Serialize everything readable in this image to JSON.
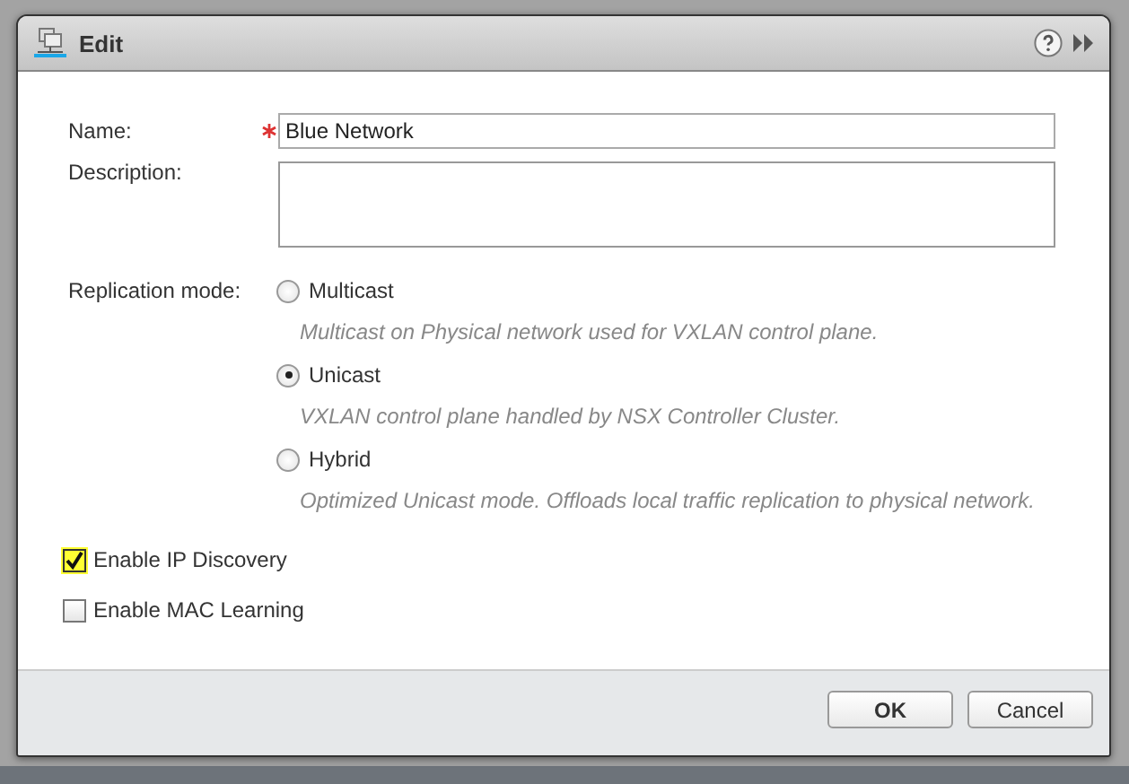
{
  "dialog": {
    "title": "Edit"
  },
  "name_field": {
    "label": "Name:",
    "required": true,
    "value": "Blue Network"
  },
  "description_field": {
    "label": "Description:"
  },
  "replication_mode": {
    "label": "Replication mode:",
    "options": [
      {
        "label": "Multicast",
        "selected": false,
        "description": "Multicast on Physical network used for VXLAN control plane."
      },
      {
        "label": "Unicast",
        "selected": true,
        "description": "VXLAN control plane handled by NSX Controller Cluster."
      },
      {
        "label": "Hybrid",
        "selected": false,
        "description": "Optimized Unicast mode. Offloads local traffic replication to physical network."
      }
    ]
  },
  "checkboxes": [
    {
      "label": "Enable IP Discovery",
      "checked": true
    },
    {
      "label": "Enable MAC Learning",
      "checked": false
    }
  ],
  "buttons": [
    "OK",
    "Cancel"
  ]
}
